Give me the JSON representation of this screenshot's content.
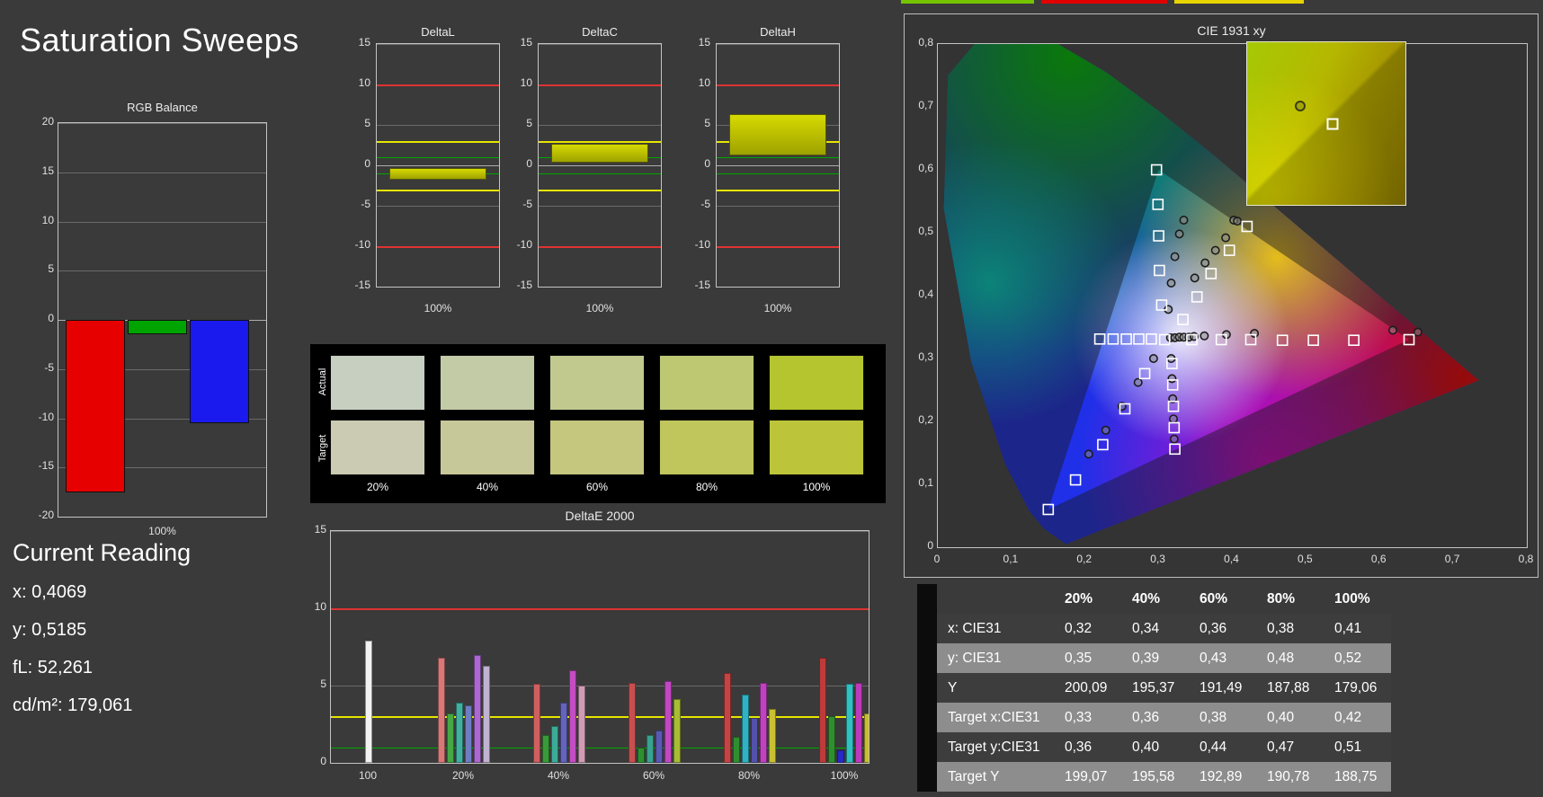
{
  "app": {
    "title": "Saturation Sweeps"
  },
  "top_strip": {
    "colors": [
      "#74c400",
      "#e00000",
      "#e8d400"
    ]
  },
  "current_reading": {
    "heading": "Current Reading",
    "lines": [
      "x: 0,4069",
      "y: 0,5185",
      "fL: 52,261",
      "cd/m²: 179,061"
    ]
  },
  "swatches": {
    "row_labels": [
      "Actual",
      "Target"
    ],
    "col_labels": [
      "20%",
      "40%",
      "60%",
      "80%",
      "100%"
    ],
    "actual_colors": [
      "#c6cfc0",
      "#c3cba6",
      "#c1c98e",
      "#bec873",
      "#b5c52f"
    ],
    "target_colors": [
      "#cacbb2",
      "#c7c899",
      "#c4c77d",
      "#c0c55c",
      "#bcc539"
    ]
  },
  "table": {
    "headers": [
      "",
      "20%",
      "40%",
      "60%",
      "80%",
      "100%"
    ],
    "rows": [
      {
        "label": "x: CIE31",
        "values": [
          "0,32",
          "0,34",
          "0,36",
          "0,38",
          "0,41"
        ]
      },
      {
        "label": "y: CIE31",
        "values": [
          "0,35",
          "0,39",
          "0,43",
          "0,48",
          "0,52"
        ]
      },
      {
        "label": "Y",
        "values": [
          "200,09",
          "195,37",
          "191,49",
          "187,88",
          "179,06"
        ]
      },
      {
        "label": "Target x:CIE31",
        "values": [
          "0,33",
          "0,36",
          "0,38",
          "0,40",
          "0,42"
        ]
      },
      {
        "label": "Target y:CIE31",
        "values": [
          "0,36",
          "0,40",
          "0,44",
          "0,47",
          "0,51"
        ]
      },
      {
        "label": "Target Y",
        "values": [
          "199,07",
          "195,58",
          "192,89",
          "190,78",
          "188,75"
        ]
      }
    ]
  },
  "chart_data": [
    {
      "id": "rgb_balance",
      "type": "bar",
      "title": "RGB Balance",
      "xlabel": "100%",
      "ylim": [
        -20,
        20
      ],
      "yticks": [
        20,
        15,
        10,
        5,
        0,
        -5,
        -10,
        -15,
        -20
      ],
      "categories": [
        "Red",
        "Green",
        "Blue"
      ],
      "values": [
        -17.5,
        -1.5,
        -10.5
      ],
      "colors": [
        "#e60000",
        "#00a400",
        "#1a1aee"
      ]
    },
    {
      "id": "delta_l",
      "type": "range-bar",
      "title": "DeltaL",
      "xlabel": "100%",
      "ylim": [
        -15,
        15
      ],
      "yticks": [
        15,
        10,
        5,
        0,
        -5,
        -10,
        -15
      ],
      "limit_lines": {
        "red": [
          10,
          -10
        ],
        "yellow": [
          3,
          -3
        ],
        "green": [
          1,
          -1
        ]
      },
      "bar": {
        "from": -1.8,
        "to": -0.3
      }
    },
    {
      "id": "delta_c",
      "type": "range-bar",
      "title": "DeltaC",
      "xlabel": "100%",
      "ylim": [
        -15,
        15
      ],
      "yticks": [
        15,
        10,
        5,
        0,
        -5,
        -10,
        -15
      ],
      "limit_lines": {
        "red": [
          10,
          -10
        ],
        "yellow": [
          3,
          -3
        ],
        "green": [
          1,
          -1
        ]
      },
      "bar": {
        "from": 0.3,
        "to": 2.7
      }
    },
    {
      "id": "delta_h",
      "type": "range-bar",
      "title": "DeltaH",
      "xlabel": "100%",
      "ylim": [
        -15,
        15
      ],
      "yticks": [
        15,
        10,
        5,
        0,
        -5,
        -10,
        -15
      ],
      "limit_lines": {
        "red": [
          10,
          -10
        ],
        "yellow": [
          3,
          -3
        ],
        "green": [
          1,
          -1
        ]
      },
      "bar": {
        "from": 1.2,
        "to": 6.3
      }
    },
    {
      "id": "delta_e_2000",
      "type": "grouped-bar",
      "title": "DeltaE 2000",
      "ylim": [
        0,
        15
      ],
      "yticks": [
        15,
        10,
        5,
        0
      ],
      "gridlines": [
        5,
        10,
        15
      ],
      "limit_lines": {
        "red": 10,
        "yellow": 3,
        "green": 1
      },
      "categories": [
        "100",
        "20%",
        "40%",
        "60%",
        "80%",
        "100%"
      ],
      "groups": [
        {
          "values": [
            7.9
          ],
          "colors": [
            "#f2f2f2"
          ]
        },
        {
          "values": [
            6.8,
            3.2,
            3.9,
            3.7,
            7.0,
            6.3
          ],
          "colors": [
            "#d87878",
            "#44a844",
            "#40b0a0",
            "#6e7ec4",
            "#aa68d0",
            "#c2b2d2"
          ]
        },
        {
          "values": [
            5.1,
            1.8,
            2.4,
            3.9,
            6.0,
            5.0
          ],
          "colors": [
            "#d06060",
            "#3a9a3a",
            "#3cab98",
            "#6464bc",
            "#c44cc4",
            "#cf9cb4"
          ]
        },
        {
          "values": [
            5.2,
            1.0,
            1.8,
            2.1,
            5.3,
            4.1
          ],
          "colors": [
            "#c84f4f",
            "#2f8f2f",
            "#38a390",
            "#5a5ab4",
            "#c148c1",
            "#a8bc34"
          ]
        },
        {
          "values": [
            5.8,
            1.7,
            4.4,
            2.9,
            5.2,
            3.5
          ],
          "colors": [
            "#c44444",
            "#2f8f2f",
            "#2fb2c4",
            "#5252ac",
            "#bf42bf",
            "#c9c132"
          ]
        },
        {
          "values": [
            6.8,
            3.0,
            0.8,
            5.1,
            5.2,
            3.2
          ],
          "colors": [
            "#c03a3a",
            "#2f8f2f",
            "#2828c8",
            "#30c2c2",
            "#bd3abd",
            "#c6be2a"
          ]
        }
      ]
    },
    {
      "id": "cie_1931_xy",
      "type": "scatter",
      "title": "CIE 1931 xy",
      "xlim": [
        0,
        0.8
      ],
      "ylim": [
        0,
        0.8
      ],
      "xtick_labels": [
        "0",
        "0,1",
        "0,2",
        "0,3",
        "0,4",
        "0,5",
        "0,6",
        "0,7",
        "0,8"
      ],
      "ytick_labels": [
        "0",
        "0,1",
        "0,2",
        "0,3",
        "0,4",
        "0,5",
        "0,6",
        "0,7",
        "0,8"
      ],
      "gamut_triangle": [
        [
          0.64,
          0.33
        ],
        [
          0.3,
          0.6
        ],
        [
          0.15,
          0.06
        ]
      ],
      "targets": [
        [
          0.308,
          0.33
        ],
        [
          0.345,
          0.33
        ],
        [
          0.385,
          0.33
        ],
        [
          0.425,
          0.33
        ],
        [
          0.468,
          0.329
        ],
        [
          0.51,
          0.329
        ],
        [
          0.565,
          0.329
        ],
        [
          0.64,
          0.33
        ],
        [
          0.304,
          0.385
        ],
        [
          0.301,
          0.44
        ],
        [
          0.3,
          0.495
        ],
        [
          0.299,
          0.545
        ],
        [
          0.297,
          0.6
        ],
        [
          0.281,
          0.276
        ],
        [
          0.254,
          0.22
        ],
        [
          0.224,
          0.163
        ],
        [
          0.187,
          0.107
        ],
        [
          0.15,
          0.06
        ],
        [
          0.29,
          0.331
        ],
        [
          0.273,
          0.331
        ],
        [
          0.256,
          0.331
        ],
        [
          0.238,
          0.331
        ],
        [
          0.22,
          0.331
        ],
        [
          0.318,
          0.292
        ],
        [
          0.319,
          0.258
        ],
        [
          0.32,
          0.224
        ],
        [
          0.321,
          0.19
        ],
        [
          0.322,
          0.156
        ],
        [
          0.333,
          0.362
        ],
        [
          0.352,
          0.398
        ],
        [
          0.371,
          0.435
        ],
        [
          0.396,
          0.472
        ],
        [
          0.42,
          0.51
        ]
      ],
      "measurements": [
        [
          0.316,
          0.333
        ],
        [
          0.322,
          0.333
        ],
        [
          0.328,
          0.334
        ],
        [
          0.334,
          0.334
        ],
        [
          0.341,
          0.334
        ],
        [
          0.348,
          0.335
        ],
        [
          0.362,
          0.336
        ],
        [
          0.392,
          0.338
        ],
        [
          0.43,
          0.34
        ],
        [
          0.618,
          0.345
        ],
        [
          0.652,
          0.342
        ],
        [
          0.313,
          0.378
        ],
        [
          0.317,
          0.42
        ],
        [
          0.322,
          0.462
        ],
        [
          0.328,
          0.498
        ],
        [
          0.334,
          0.52
        ],
        [
          0.293,
          0.3
        ],
        [
          0.272,
          0.262
        ],
        [
          0.25,
          0.224
        ],
        [
          0.228,
          0.186
        ],
        [
          0.205,
          0.148
        ],
        [
          0.317,
          0.3
        ],
        [
          0.318,
          0.268
        ],
        [
          0.319,
          0.236
        ],
        [
          0.32,
          0.204
        ],
        [
          0.321,
          0.172
        ],
        [
          0.349,
          0.428
        ],
        [
          0.363,
          0.452
        ],
        [
          0.377,
          0.472
        ],
        [
          0.391,
          0.492
        ],
        [
          0.402,
          0.52
        ],
        [
          0.4069,
          0.5185
        ]
      ],
      "inset": {
        "measured": [
          0.4069,
          0.5185
        ],
        "target": [
          0.42,
          0.51
        ]
      }
    }
  ]
}
